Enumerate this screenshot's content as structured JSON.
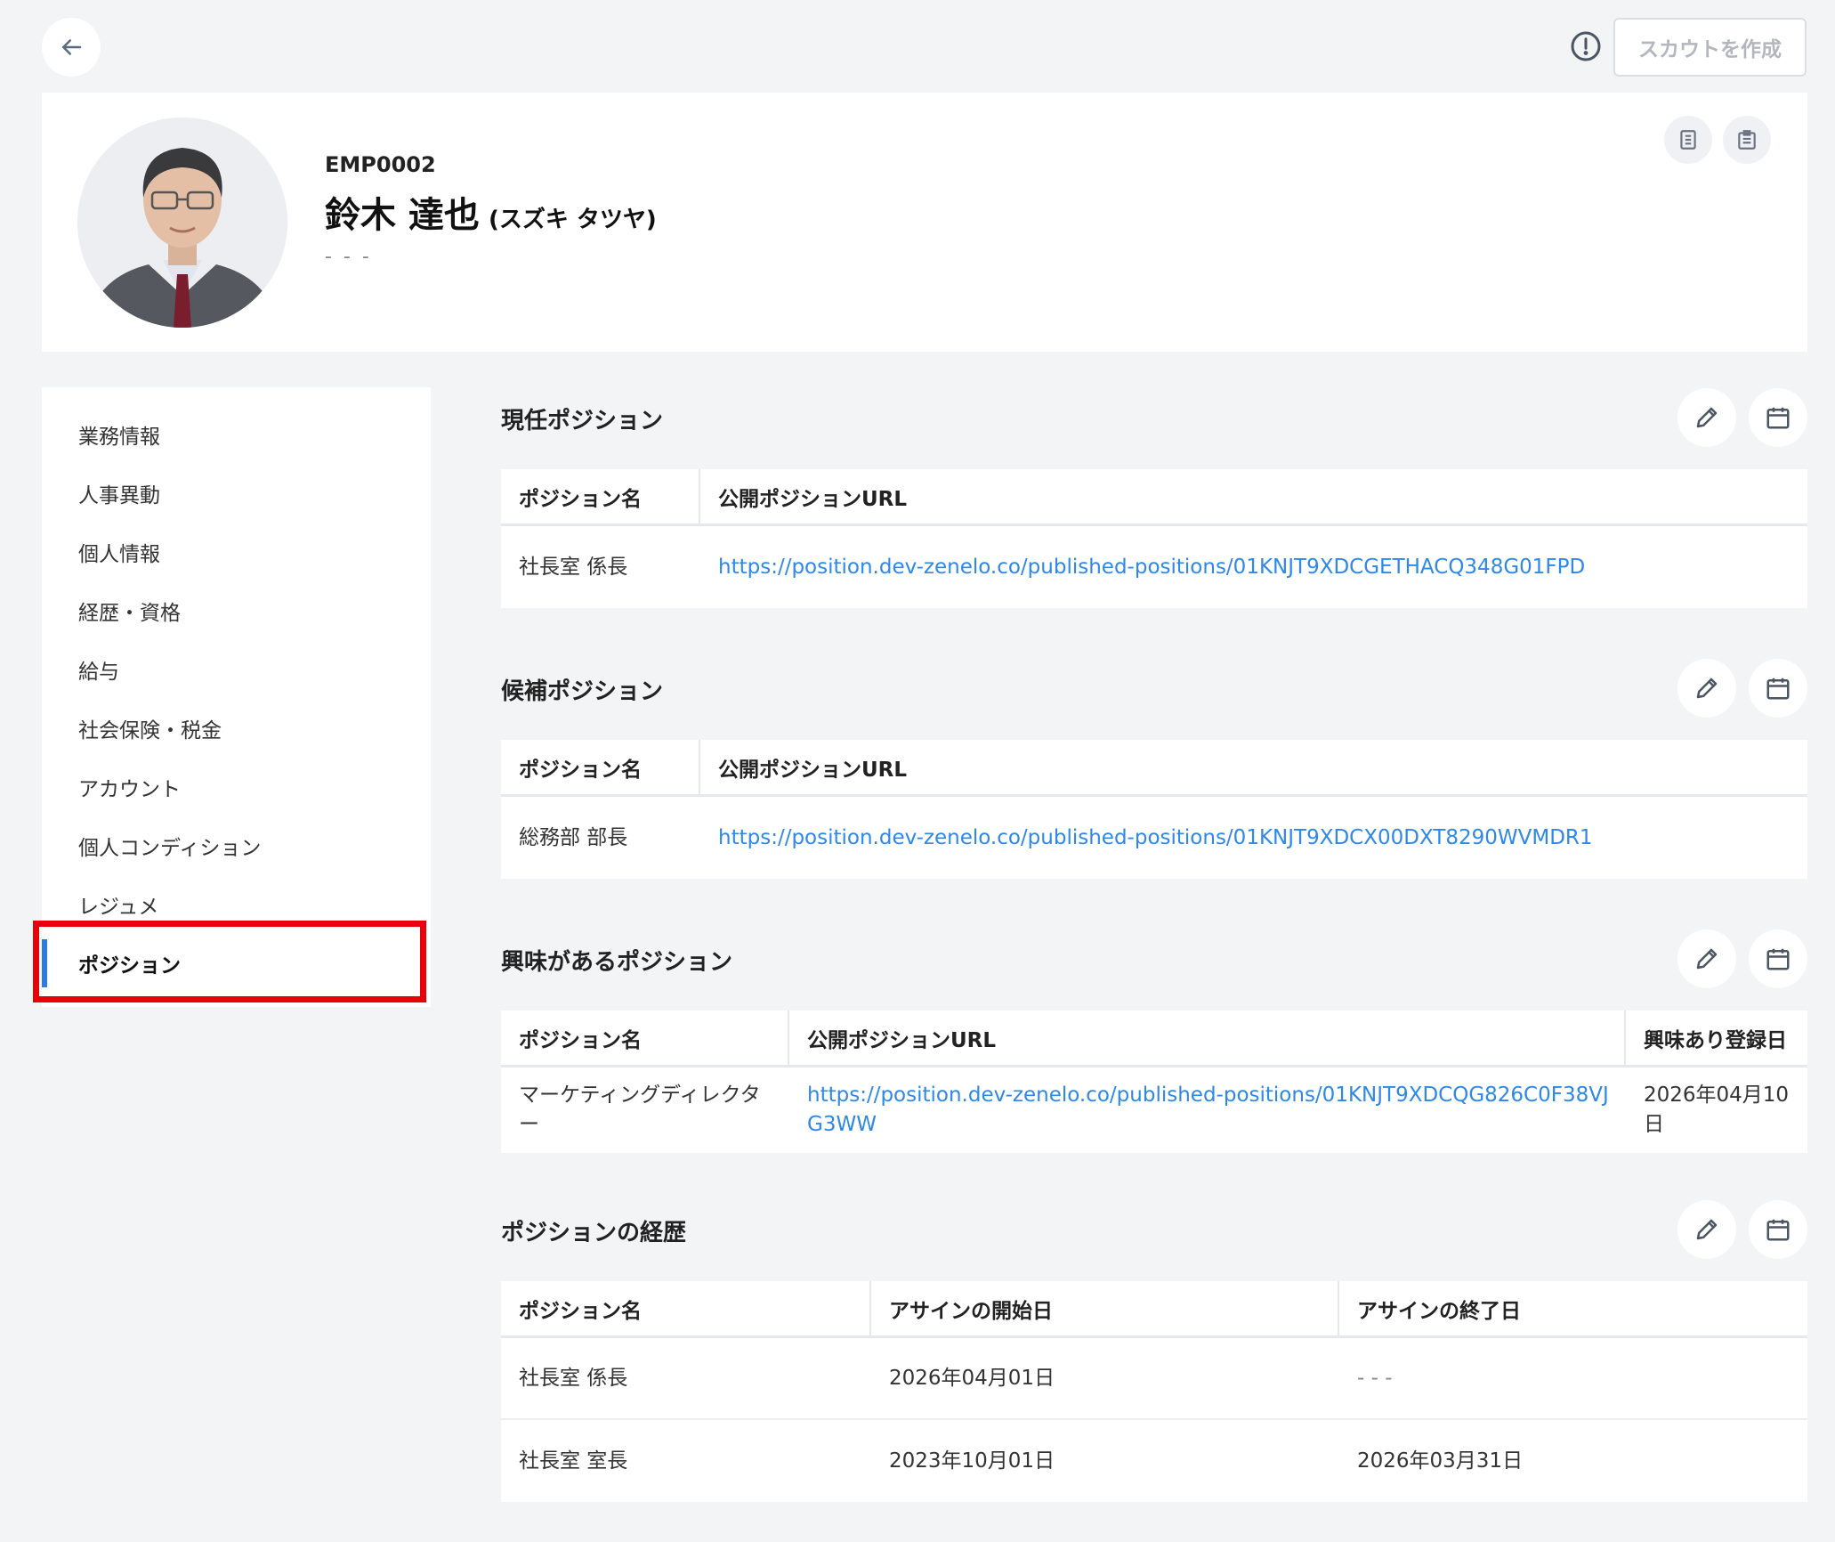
{
  "header": {
    "scout_button": "スカウトを作成"
  },
  "profile": {
    "employee_id": "EMP0002",
    "name": "鈴木 達也",
    "kana": "(スズキ タツヤ)",
    "subtitle": "- - -"
  },
  "sidebar": {
    "items": [
      {
        "label": "業務情報"
      },
      {
        "label": "人事異動"
      },
      {
        "label": "個人情報"
      },
      {
        "label": "経歴・資格"
      },
      {
        "label": "給与"
      },
      {
        "label": "社会保険・税金"
      },
      {
        "label": "アカウント"
      },
      {
        "label": "個人コンディション"
      },
      {
        "label": "レジュメ"
      },
      {
        "label": "ポジション"
      }
    ],
    "active_index": 9
  },
  "sections": {
    "current": {
      "title": "現任ポジション",
      "headers": [
        "ポジション名",
        "公開ポジションURL"
      ],
      "rows": [
        [
          "社長室 係長",
          "https://position.dev-zenelo.co/published-positions/01KNJT9XDCGETHACQ348G01FPD"
        ]
      ]
    },
    "candidate": {
      "title": "候補ポジション",
      "headers": [
        "ポジション名",
        "公開ポジションURL"
      ],
      "rows": [
        [
          "総務部 部長",
          "https://position.dev-zenelo.co/published-positions/01KNJT9XDCX00DXT8290WVMDR1"
        ]
      ]
    },
    "interest": {
      "title": "興味があるポジション",
      "headers": [
        "ポジション名",
        "公開ポジションURL",
        "興味あり登録日"
      ],
      "rows": [
        [
          "マーケティングディレクター",
          "https://position.dev-zenelo.co/published-positions/01KNJT9XDCQG826C0F38VJG3WW",
          "2026年04月10日"
        ]
      ]
    },
    "history": {
      "title": "ポジションの経歴",
      "headers": [
        "ポジション名",
        "アサインの開始日",
        "アサインの終了日"
      ],
      "rows": [
        [
          "社長室 係長",
          "2026年04月01日",
          "- - -"
        ],
        [
          "社長室 室長",
          "2023年10月01日",
          "2026年03月31日"
        ]
      ]
    }
  },
  "colors": {
    "accent": "#2d7be5",
    "link": "#2d88e8",
    "highlight": "#e8000b",
    "background": "#f3f4f6"
  },
  "icons": [
    "back-arrow-icon",
    "alert-circle-icon",
    "document-icon",
    "clipboard-icon",
    "pencil-icon",
    "calendar-icon"
  ]
}
